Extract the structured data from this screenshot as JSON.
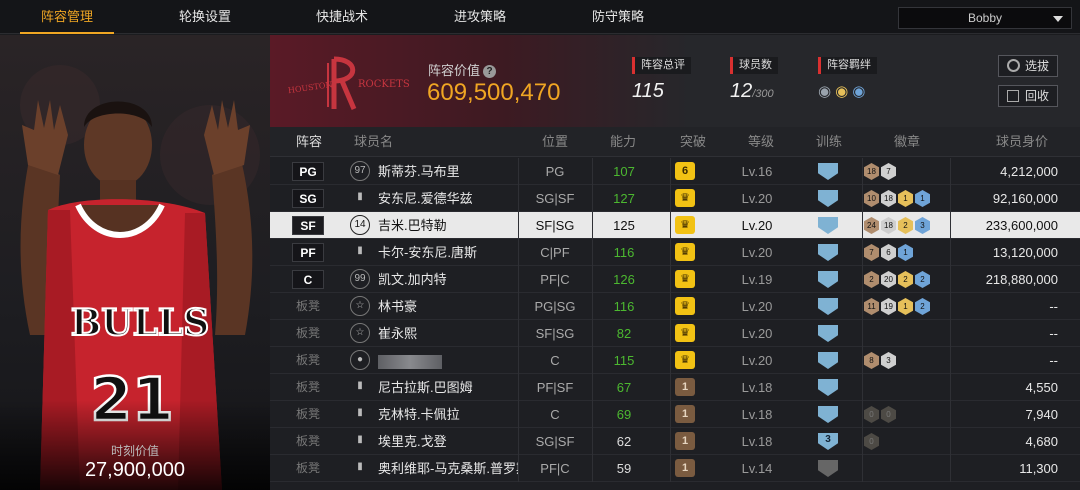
{
  "nav": {
    "tabs": [
      "阵容管理",
      "轮换设置",
      "快捷战术",
      "进攻策略",
      "防守策略"
    ],
    "active_tab": 0,
    "user": "Bobby"
  },
  "player_card": {
    "value_caption": "时刻价值",
    "value": "27,900,000",
    "jersey_text": "BULLS",
    "jersey_number": "21"
  },
  "team": {
    "logo_text": "HOUSTON ROCKETS",
    "roster_value_label": "阵容价值",
    "roster_value": "609,500,470",
    "rating_label": "阵容总评",
    "rating": "115",
    "count_label": "球员数",
    "count": "12",
    "count_max": "/300",
    "bond_label": "阵容羁绊",
    "select_btn": "选拔",
    "recycle_btn": "回收"
  },
  "table": {
    "headers": [
      "阵容",
      "球员名",
      "位置",
      "能力",
      "突破",
      "等级",
      "训练",
      "徽章",
      "球员身价"
    ],
    "rows": [
      {
        "pos": "PG",
        "starter": true,
        "jersey": "97",
        "name": "斯蒂芬.马布里",
        "position": "PG",
        "ability": "107",
        "ability_green": true,
        "break": "6",
        "break_gold": true,
        "level": "Lv.16",
        "train": "",
        "badges": [
          [
            "bz",
            "18"
          ],
          [
            "sv",
            "7"
          ]
        ],
        "price": "4,212,000"
      },
      {
        "pos": "SG",
        "starter": true,
        "jersey": "bars",
        "name": "安东尼.爱德华兹",
        "position": "SG|SF",
        "ability": "127",
        "ability_green": true,
        "break": "♛",
        "break_gold": true,
        "level": "Lv.20",
        "train": "",
        "badges": [
          [
            "bz",
            "10"
          ],
          [
            "sv",
            "18"
          ],
          [
            "gd",
            "1"
          ],
          [
            "bl",
            "1"
          ]
        ],
        "price": "92,160,000"
      },
      {
        "pos": "SF",
        "starter": true,
        "selected": true,
        "jersey": "14",
        "name": "吉米.巴特勒",
        "position": "SF|SG",
        "ability": "125",
        "ability_green": false,
        "break": "♛",
        "break_gold": true,
        "level": "Lv.20",
        "train": "",
        "badges": [
          [
            "bz",
            "24"
          ],
          [
            "sv",
            "18"
          ],
          [
            "gd",
            "2"
          ],
          [
            "bl",
            "3"
          ]
        ],
        "price": "233,600,000"
      },
      {
        "pos": "PF",
        "starter": true,
        "jersey": "bars",
        "name": "卡尔-安东尼.唐斯",
        "position": "C|PF",
        "ability": "116",
        "ability_green": true,
        "break": "♛",
        "break_gold": true,
        "level": "Lv.20",
        "train": "",
        "badges": [
          [
            "bz",
            "7"
          ],
          [
            "sv",
            "6"
          ],
          [
            "bl",
            "1"
          ]
        ],
        "price": "13,120,000"
      },
      {
        "pos": "C",
        "starter": true,
        "jersey": "99",
        "name": "凯文.加内特",
        "position": "PF|C",
        "ability": "126",
        "ability_green": true,
        "break": "♛",
        "break_gold": true,
        "level": "Lv.19",
        "train": "",
        "badges": [
          [
            "bz",
            "2"
          ],
          [
            "sv",
            "20"
          ],
          [
            "gd",
            "2"
          ],
          [
            "bl",
            "2"
          ]
        ],
        "price": "218,880,000"
      },
      {
        "pos": "板凳",
        "starter": false,
        "jersey": "star",
        "name": "林书豪",
        "position": "PG|SG",
        "ability": "116",
        "ability_green": true,
        "break": "♛",
        "break_gold": true,
        "level": "Lv.20",
        "train": "",
        "badges": [
          [
            "bz",
            "11"
          ],
          [
            "sv",
            "19"
          ],
          [
            "gd",
            "1"
          ],
          [
            "bl",
            "2"
          ]
        ],
        "price": "--"
      },
      {
        "pos": "板凳",
        "starter": false,
        "jersey": "star",
        "name": "崔永熙",
        "position": "SF|SG",
        "ability": "82",
        "ability_green": true,
        "break": "♛",
        "break_gold": true,
        "level": "Lv.20",
        "train": "",
        "badges": [],
        "price": "--"
      },
      {
        "pos": "板凳",
        "starter": false,
        "jersey": "person",
        "name": "",
        "blurred": true,
        "position": "C",
        "ability": "115",
        "ability_green": true,
        "break": "♛",
        "break_gold": true,
        "level": "Lv.20",
        "train": "",
        "badges": [
          [
            "bz",
            "8"
          ],
          [
            "sv",
            "3"
          ]
        ],
        "price": "--"
      },
      {
        "pos": "板凳",
        "starter": false,
        "jersey": "bars",
        "name": "尼古拉斯.巴图姆",
        "position": "PF|SF",
        "ability": "67",
        "ability_green": true,
        "break": "1",
        "break_gold": false,
        "level": "Lv.18",
        "train": "",
        "badges": [],
        "price": "4,550"
      },
      {
        "pos": "板凳",
        "starter": false,
        "jersey": "bars",
        "name": "克林特.卡佩拉",
        "position": "C",
        "ability": "69",
        "ability_green": true,
        "break": "1",
        "break_gold": false,
        "level": "Lv.18",
        "train": "",
        "badges": [
          [
            "dk",
            "0"
          ],
          [
            "dk",
            "0"
          ]
        ],
        "price": "7,940"
      },
      {
        "pos": "板凳",
        "starter": false,
        "jersey": "bars",
        "name": "埃里克.戈登",
        "position": "SG|SF",
        "ability": "62",
        "ability_green": false,
        "break": "1",
        "break_gold": false,
        "level": "Lv.18",
        "train": "3",
        "badges": [
          [
            "dk",
            "0"
          ]
        ],
        "price": "4,680"
      },
      {
        "pos": "板凳",
        "starter": false,
        "jersey": "bars",
        "name": "奥利维耶-马克桑斯.普罗斯珀",
        "position": "PF|C",
        "ability": "59",
        "ability_green": false,
        "break": "1",
        "break_gold": false,
        "level": "Lv.14",
        "train": "gray",
        "badges": [],
        "price": "11,300"
      }
    ]
  }
}
